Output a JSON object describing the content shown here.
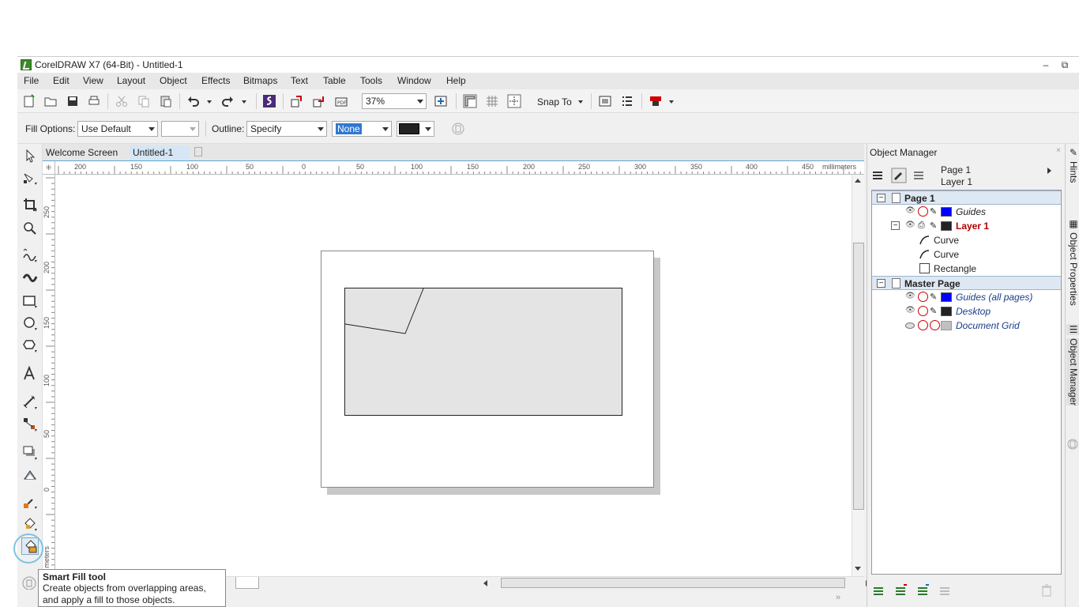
{
  "window": {
    "title": "CorelDRAW X7 (64-Bit) - Untitled-1",
    "minimize_glyph": "–",
    "restore_glyph": "⧉"
  },
  "menu": [
    "File",
    "Edit",
    "View",
    "Layout",
    "Object",
    "Effects",
    "Bitmaps",
    "Text",
    "Table",
    "Tools",
    "Window",
    "Help"
  ],
  "toolbar": {
    "zoom_value": "37%",
    "snap_label": "Snap To"
  },
  "property_bar": {
    "fill_options_label": "Fill Options:",
    "fill_value": "Use Default",
    "outline_label": "Outline:",
    "outline_value": "Specify",
    "outline_width": "None",
    "outline_color": "#222222"
  },
  "doc_tabs": [
    "Welcome Screen",
    "Untitled-1"
  ],
  "ruler": {
    "units": "millimeters",
    "h_ticks": [
      "200",
      "150",
      "100",
      "50",
      "0",
      "50",
      "100",
      "150",
      "200",
      "250",
      "300",
      "350",
      "400",
      "450"
    ],
    "v_ticks": [
      "250",
      "200",
      "150",
      "100",
      "50",
      "0"
    ],
    "v_units": "meters"
  },
  "object_manager": {
    "title": "Object Manager",
    "current_page": "Page 1",
    "current_layer": "Layer 1",
    "tree": [
      {
        "label": "Page 1",
        "kind": "page",
        "bold": true
      },
      {
        "label": "Guides",
        "kind": "layer",
        "color": "#0000ff",
        "italic": true
      },
      {
        "label": "Layer 1",
        "kind": "layer-active",
        "color": "#222222",
        "bold": true,
        "text_color": "#b00000"
      },
      {
        "label": "Curve",
        "kind": "curve"
      },
      {
        "label": "Curve",
        "kind": "curve"
      },
      {
        "label": "Rectangle",
        "kind": "rect"
      },
      {
        "label": "Master Page",
        "kind": "page",
        "bold": true
      },
      {
        "label": "Guides (all pages)",
        "kind": "layer",
        "color": "#0000ff",
        "italic": true,
        "text_color": "#1a3d8a"
      },
      {
        "label": "Desktop",
        "kind": "layer",
        "color": "#222222",
        "italic": true,
        "text_color": "#1a3d8a"
      },
      {
        "label": "Document Grid",
        "kind": "layer-grid",
        "color": "#c0c0c0",
        "italic": true,
        "text_color": "#1a3d8a"
      }
    ]
  },
  "side_tabs": [
    "Hints",
    "Object Properties",
    "Object Manager"
  ],
  "tooltip": {
    "title": "Smart Fill tool",
    "desc": "Create objects from overlapping areas, and apply a fill to those objects."
  }
}
